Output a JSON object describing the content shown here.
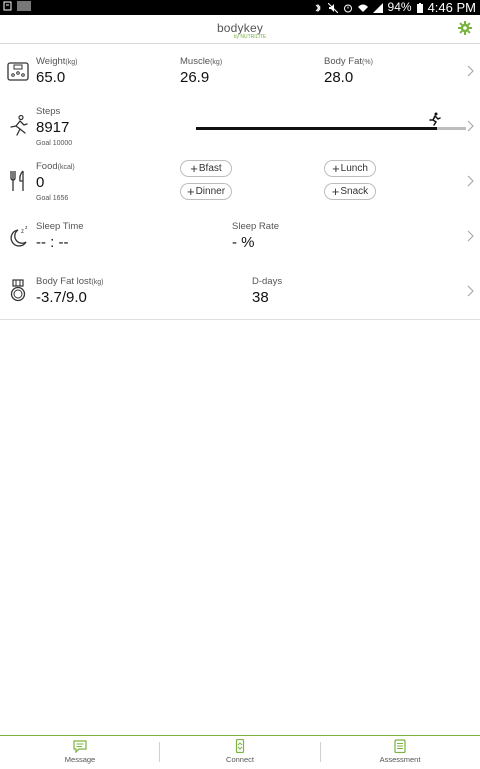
{
  "status_bar": {
    "battery": "94%",
    "time": "4:46 PM"
  },
  "header": {
    "logo_text": "bodykey",
    "logo_sub": "by NUTRILITE"
  },
  "rows": {
    "weight": {
      "label": "Weight",
      "unit": "(kg)",
      "value": "65.0"
    },
    "muscle": {
      "label": "Muscle",
      "unit": "(kg)",
      "value": "26.9"
    },
    "bodyfat": {
      "label": "Body Fat",
      "unit": "(%)",
      "value": "28.0"
    },
    "steps": {
      "label": "Steps",
      "value": "8917",
      "goal": "Goal  10000",
      "progress": 0.8917
    },
    "food": {
      "label": "Food",
      "unit": "(kcal)",
      "value": "0",
      "goal": "Goal  1656",
      "buttons": {
        "bfast": "Bfast",
        "lunch": "Lunch",
        "dinner": "Dinner",
        "snack": "Snack"
      }
    },
    "sleep_time": {
      "label": "Sleep Time",
      "value": "-- : --"
    },
    "sleep_rate": {
      "label": "Sleep Rate",
      "value": "- %"
    },
    "bodyfat_lost": {
      "label": "Body Fat lost",
      "unit": "(kg)",
      "value": "-3.7/9.0"
    },
    "ddays": {
      "label": "D-days",
      "value": "38"
    }
  },
  "tabs": {
    "message": "Message",
    "connect": "Connect",
    "assessment": "Assessment"
  },
  "colors": {
    "accent": "#7ab33e"
  }
}
